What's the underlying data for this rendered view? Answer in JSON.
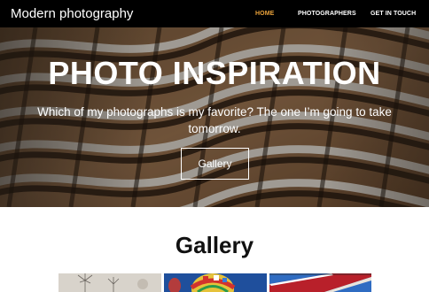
{
  "navbar": {
    "brand": "Modern photography",
    "links": [
      {
        "label": "HOME",
        "active": true
      },
      {
        "label": "PHOTOGRAPHERS",
        "active": false
      },
      {
        "label": "GET IN TOUCH",
        "active": false
      }
    ],
    "active_color": "#e9a13a"
  },
  "hero": {
    "title": "PHOTO INSPIRATION",
    "subtitle": "Which of my photographs is my favorite? The one I’m going to take tomorrow.",
    "button_label": "Gallery"
  },
  "gallery": {
    "title": "Gallery",
    "images": [
      {
        "subject": "dandelion seeds"
      },
      {
        "subject": "hot air balloons"
      },
      {
        "subject": "red roof under blue sky"
      }
    ]
  }
}
